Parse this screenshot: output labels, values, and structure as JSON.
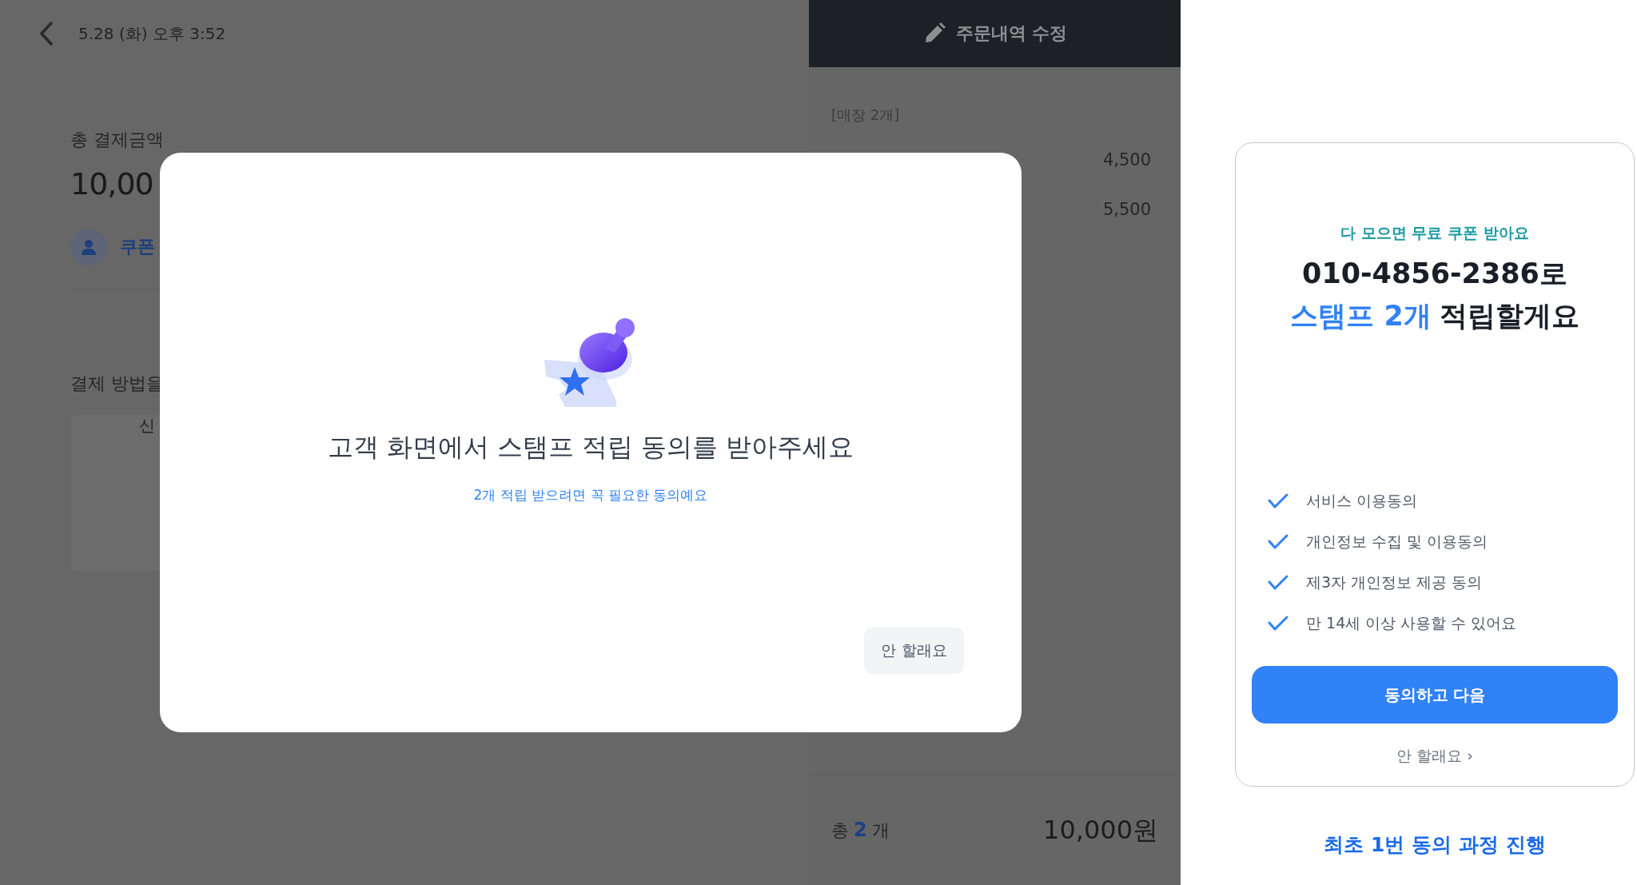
{
  "header": {
    "date": "5.28 (화) 오후 3:52",
    "edit_button": "주문내역 수정"
  },
  "payment": {
    "total_label": "총 결제금액",
    "total_amount": "10,00",
    "coupon_label": "쿠폰",
    "method_label": "결제 방법을",
    "method_option": "신"
  },
  "order": {
    "group_label": "[매장 2개]",
    "prices": [
      "4,500",
      "5,500"
    ],
    "count_label": "총",
    "count": "2",
    "count_unit": "개",
    "total": "10,000원"
  },
  "modal": {
    "title": "고객 화면에서 스탬프 적립 동의를 받아주세요",
    "subtitle": "2개 적립 받으려면 꼭 필요한 동의예요",
    "button": "안 할래요"
  },
  "customer_screen": {
    "eyebrow": "다 모으면 무료 쿠폰 받아요",
    "phone_line": "010-4856-2386로",
    "highlight": "스탬프 2개",
    "rest": "적립할게요",
    "agreements": [
      {
        "label": "서비스 이용동의",
        "checked": true
      },
      {
        "label": "개인정보 수집 및 이용동의",
        "checked": true
      },
      {
        "label": "제3자 개인정보 제공 동의",
        "checked": true
      },
      {
        "label": "만 14세 이상 사용할 수 있어요",
        "checked": true
      }
    ],
    "agree_button": "동의하고 다음",
    "decline_link": "안 할래요 ›"
  },
  "caption": "최초 1번 동의 과정 진행"
}
